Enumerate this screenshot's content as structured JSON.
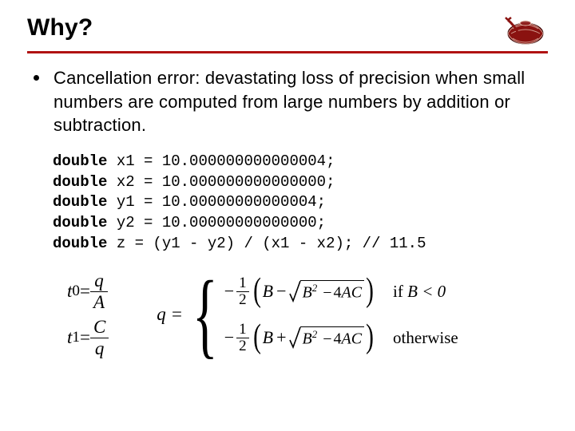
{
  "header": {
    "title": "Why?"
  },
  "bullet": {
    "text": "Cancellation error: devastating loss of precision when small numbers are computed from large numbers by addition or subtraction."
  },
  "code": {
    "kw": "double",
    "lines": {
      "l1": " x1 = 10.000000000000004;",
      "l2": " x2 = 10.000000000000000;",
      "l3": " y1 = 10.00000000000004;",
      "l4": " y2 = 10.00000000000000;",
      "l5": " z = (y1 - y2) / (x1 - x2); // 11.5"
    }
  },
  "math": {
    "t0_lhs": "t",
    "t0_sub": "0",
    "t1_lhs": "t",
    "t1_sub": "1",
    "eq": " = ",
    "q": "q",
    "A": "A",
    "C": "C",
    "q_lhs": "q = ",
    "minus": "−",
    "half_num": "1",
    "half_den": "2",
    "B": "B",
    "plus": "+",
    "B2": "B",
    "two": "2",
    "four": "4",
    "AC": "AC",
    "if": "if ",
    "cond": "B < 0",
    "otherwise": "otherwise"
  }
}
